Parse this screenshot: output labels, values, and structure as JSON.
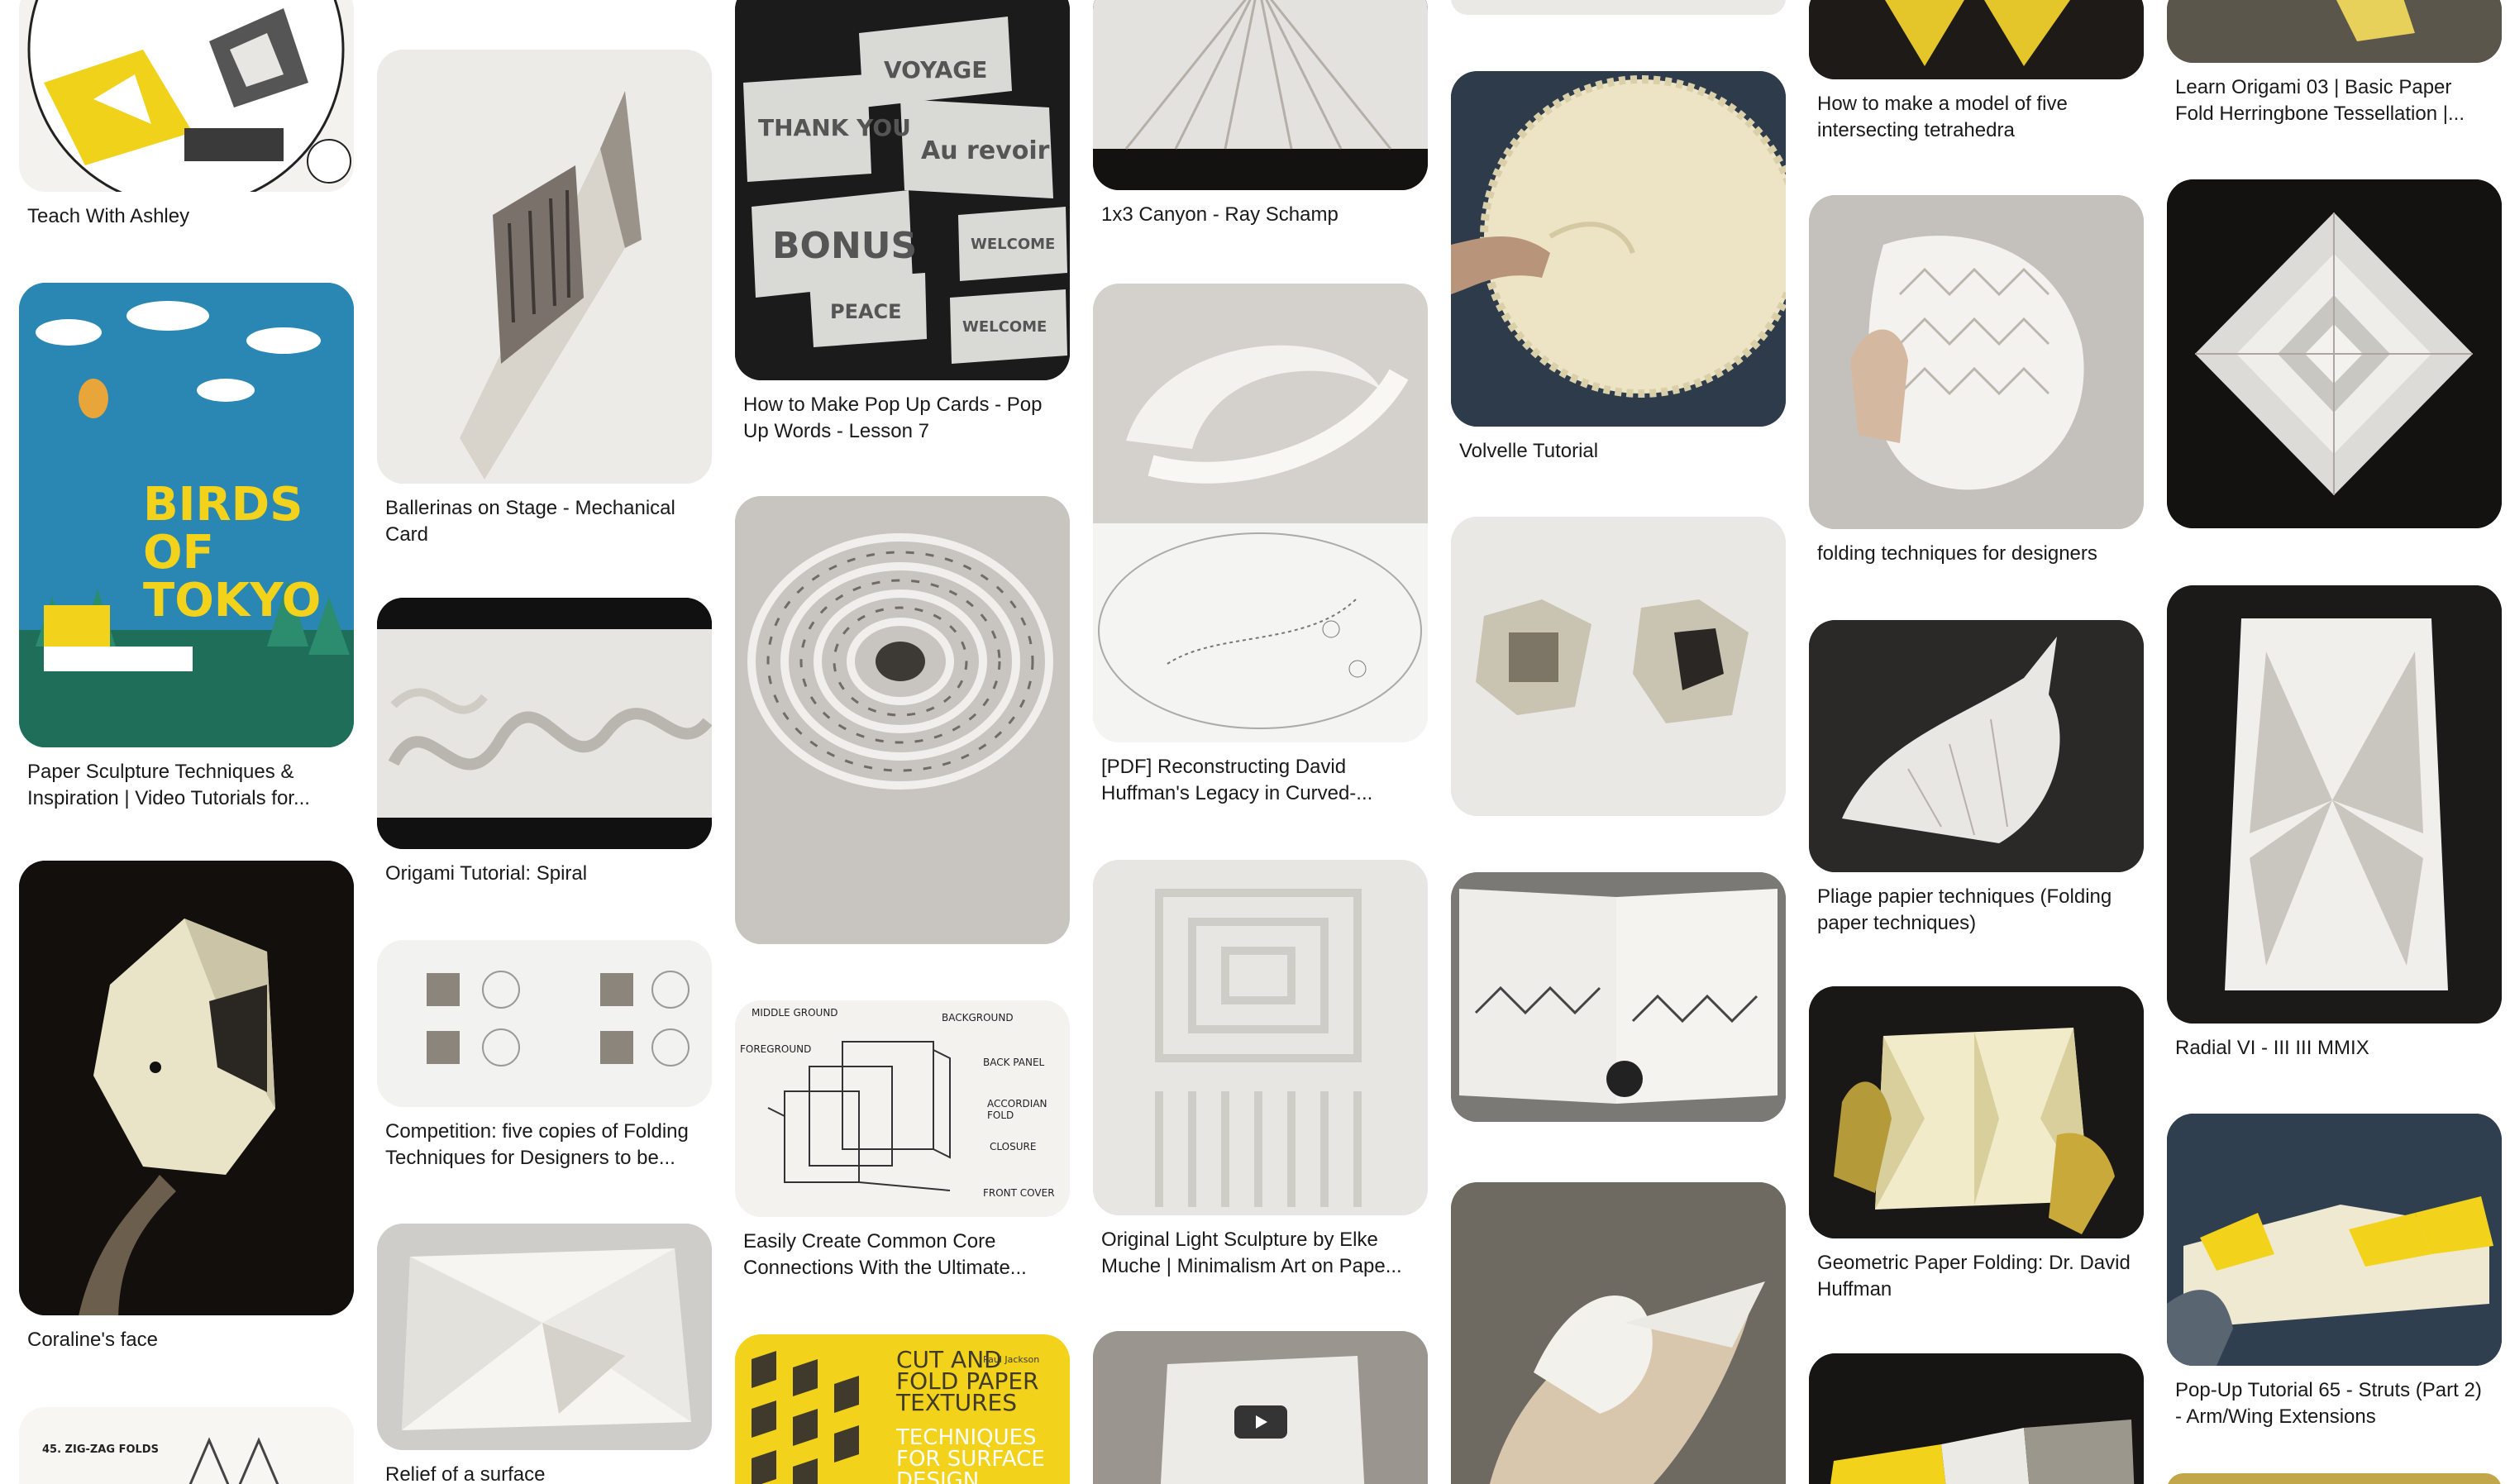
{
  "pins": {
    "teach_with_ashley": {
      "caption": "Teach With Ashley"
    },
    "paper_sculpture": {
      "caption": "Paper Sculpture Techniques & Inspiration | Video Tutorials for...",
      "poster_text": "BIRDS OF TOKYO"
    },
    "coralines_face": {
      "caption": "Coraline's face"
    },
    "zig_zag": {
      "caption": "",
      "label": "45.  ZIG-ZAG FOLDS"
    },
    "ballerinas": {
      "caption": "Ballerinas on Stage - Mechanical Card"
    },
    "origami_spiral": {
      "caption": "Origami Tutorial: Spiral"
    },
    "competition": {
      "caption": "Competition: five copies of Folding Techniques for Designers to be..."
    },
    "relief": {
      "caption": "Relief of a surface"
    },
    "pop_up_cards": {
      "caption": "How to Make Pop Up Cards - Pop Up Words - Lesson 7",
      "words": [
        "VOYAGE",
        "THANK YOU",
        "Au revoir",
        "BONUS",
        "PEACE",
        "WELCOME"
      ]
    },
    "spiral_sculpture": {
      "caption": ""
    },
    "common_core": {
      "caption": "Easily Create Common Core Connections With the Ultimate...",
      "labels": [
        "MIDDLE GROUND",
        "BACKGROUND",
        "FOREGROUND",
        "BACK PANEL",
        "ACCORDIAN FOLD",
        "CLOSURE",
        "FRONT COVER"
      ]
    },
    "cut_and_fold": {
      "caption": "",
      "title": "CUT AND FOLD PAPER TEXTURES",
      "subtitle": "TECHNIQUES FOR SURFACE DESIGN",
      "author": "Paul Jackson"
    },
    "canyon": {
      "caption": "1x3 Canyon - Ray Schamp"
    },
    "huffman_legacy": {
      "caption": "[PDF] Reconstructing David Huffman's Legacy in Curved-..."
    },
    "light_sculpture": {
      "caption": "Original Light Sculpture by Elke Muche | Minimalism Art on Pape..."
    },
    "video_fold": {
      "caption": ""
    },
    "volvelle": {
      "caption": "Volvelle Tutorial"
    },
    "boxes": {
      "caption": ""
    },
    "book_spread": {
      "caption": ""
    },
    "hummingbird": {
      "caption": ""
    },
    "tetrahedra": {
      "caption": "How to make a model of five intersecting tetrahedra"
    },
    "folding_techniques": {
      "caption": "folding techniques for designers"
    },
    "pliage": {
      "caption": "Pliage papier techniques (Folding paper techniques)"
    },
    "huffman_geometric": {
      "caption": "Geometric Paper Folding: Dr. David Huffman"
    },
    "yellow_popup": {
      "caption": ""
    },
    "herringbone": {
      "caption": "Learn Origami 03 | Basic Paper Fold Herringbone Tessellation |..."
    },
    "rose_tess": {
      "caption": ""
    },
    "radial_vi": {
      "caption": "Radial VI - III III MMIX"
    },
    "popup_65": {
      "caption": "Pop-Up Tutorial 65 - Struts (Part 2) - Arm/Wing Extensions"
    }
  },
  "colors": {
    "caption_text": "#1a1a1a",
    "accent_yellow": "#f2d21a",
    "poster_blue": "#2a7fa8",
    "dark_bg": "#141210"
  }
}
